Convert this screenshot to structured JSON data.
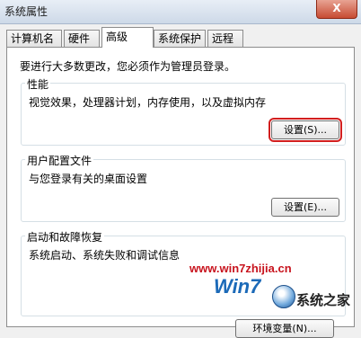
{
  "window": {
    "title": "系统属性",
    "close_label": "X"
  },
  "tabs": [
    {
      "label": "计算机名"
    },
    {
      "label": "硬件"
    },
    {
      "label": "高级",
      "active": true
    },
    {
      "label": "系统保护"
    },
    {
      "label": "远程"
    }
  ],
  "notice": "要进行大多数更改，您必须作为管理员登录。",
  "performance": {
    "title": "性能",
    "description": "视觉效果，处理器计划，内存使用，以及虚拟内存",
    "button_label": "设置(S)..."
  },
  "user_profiles": {
    "title": "用户配置文件",
    "description": "与您登录有关的桌面设置",
    "button_label": "设置(E)..."
  },
  "startup_recovery": {
    "title": "启动和故障恢复",
    "description": "系统启动、系统失败和调试信息"
  },
  "bottom_button": {
    "label": "环境变量(N)..."
  },
  "watermark": {
    "url": "www.win7zhijia.cn",
    "logo": "Win7",
    "site": "系统之家"
  }
}
